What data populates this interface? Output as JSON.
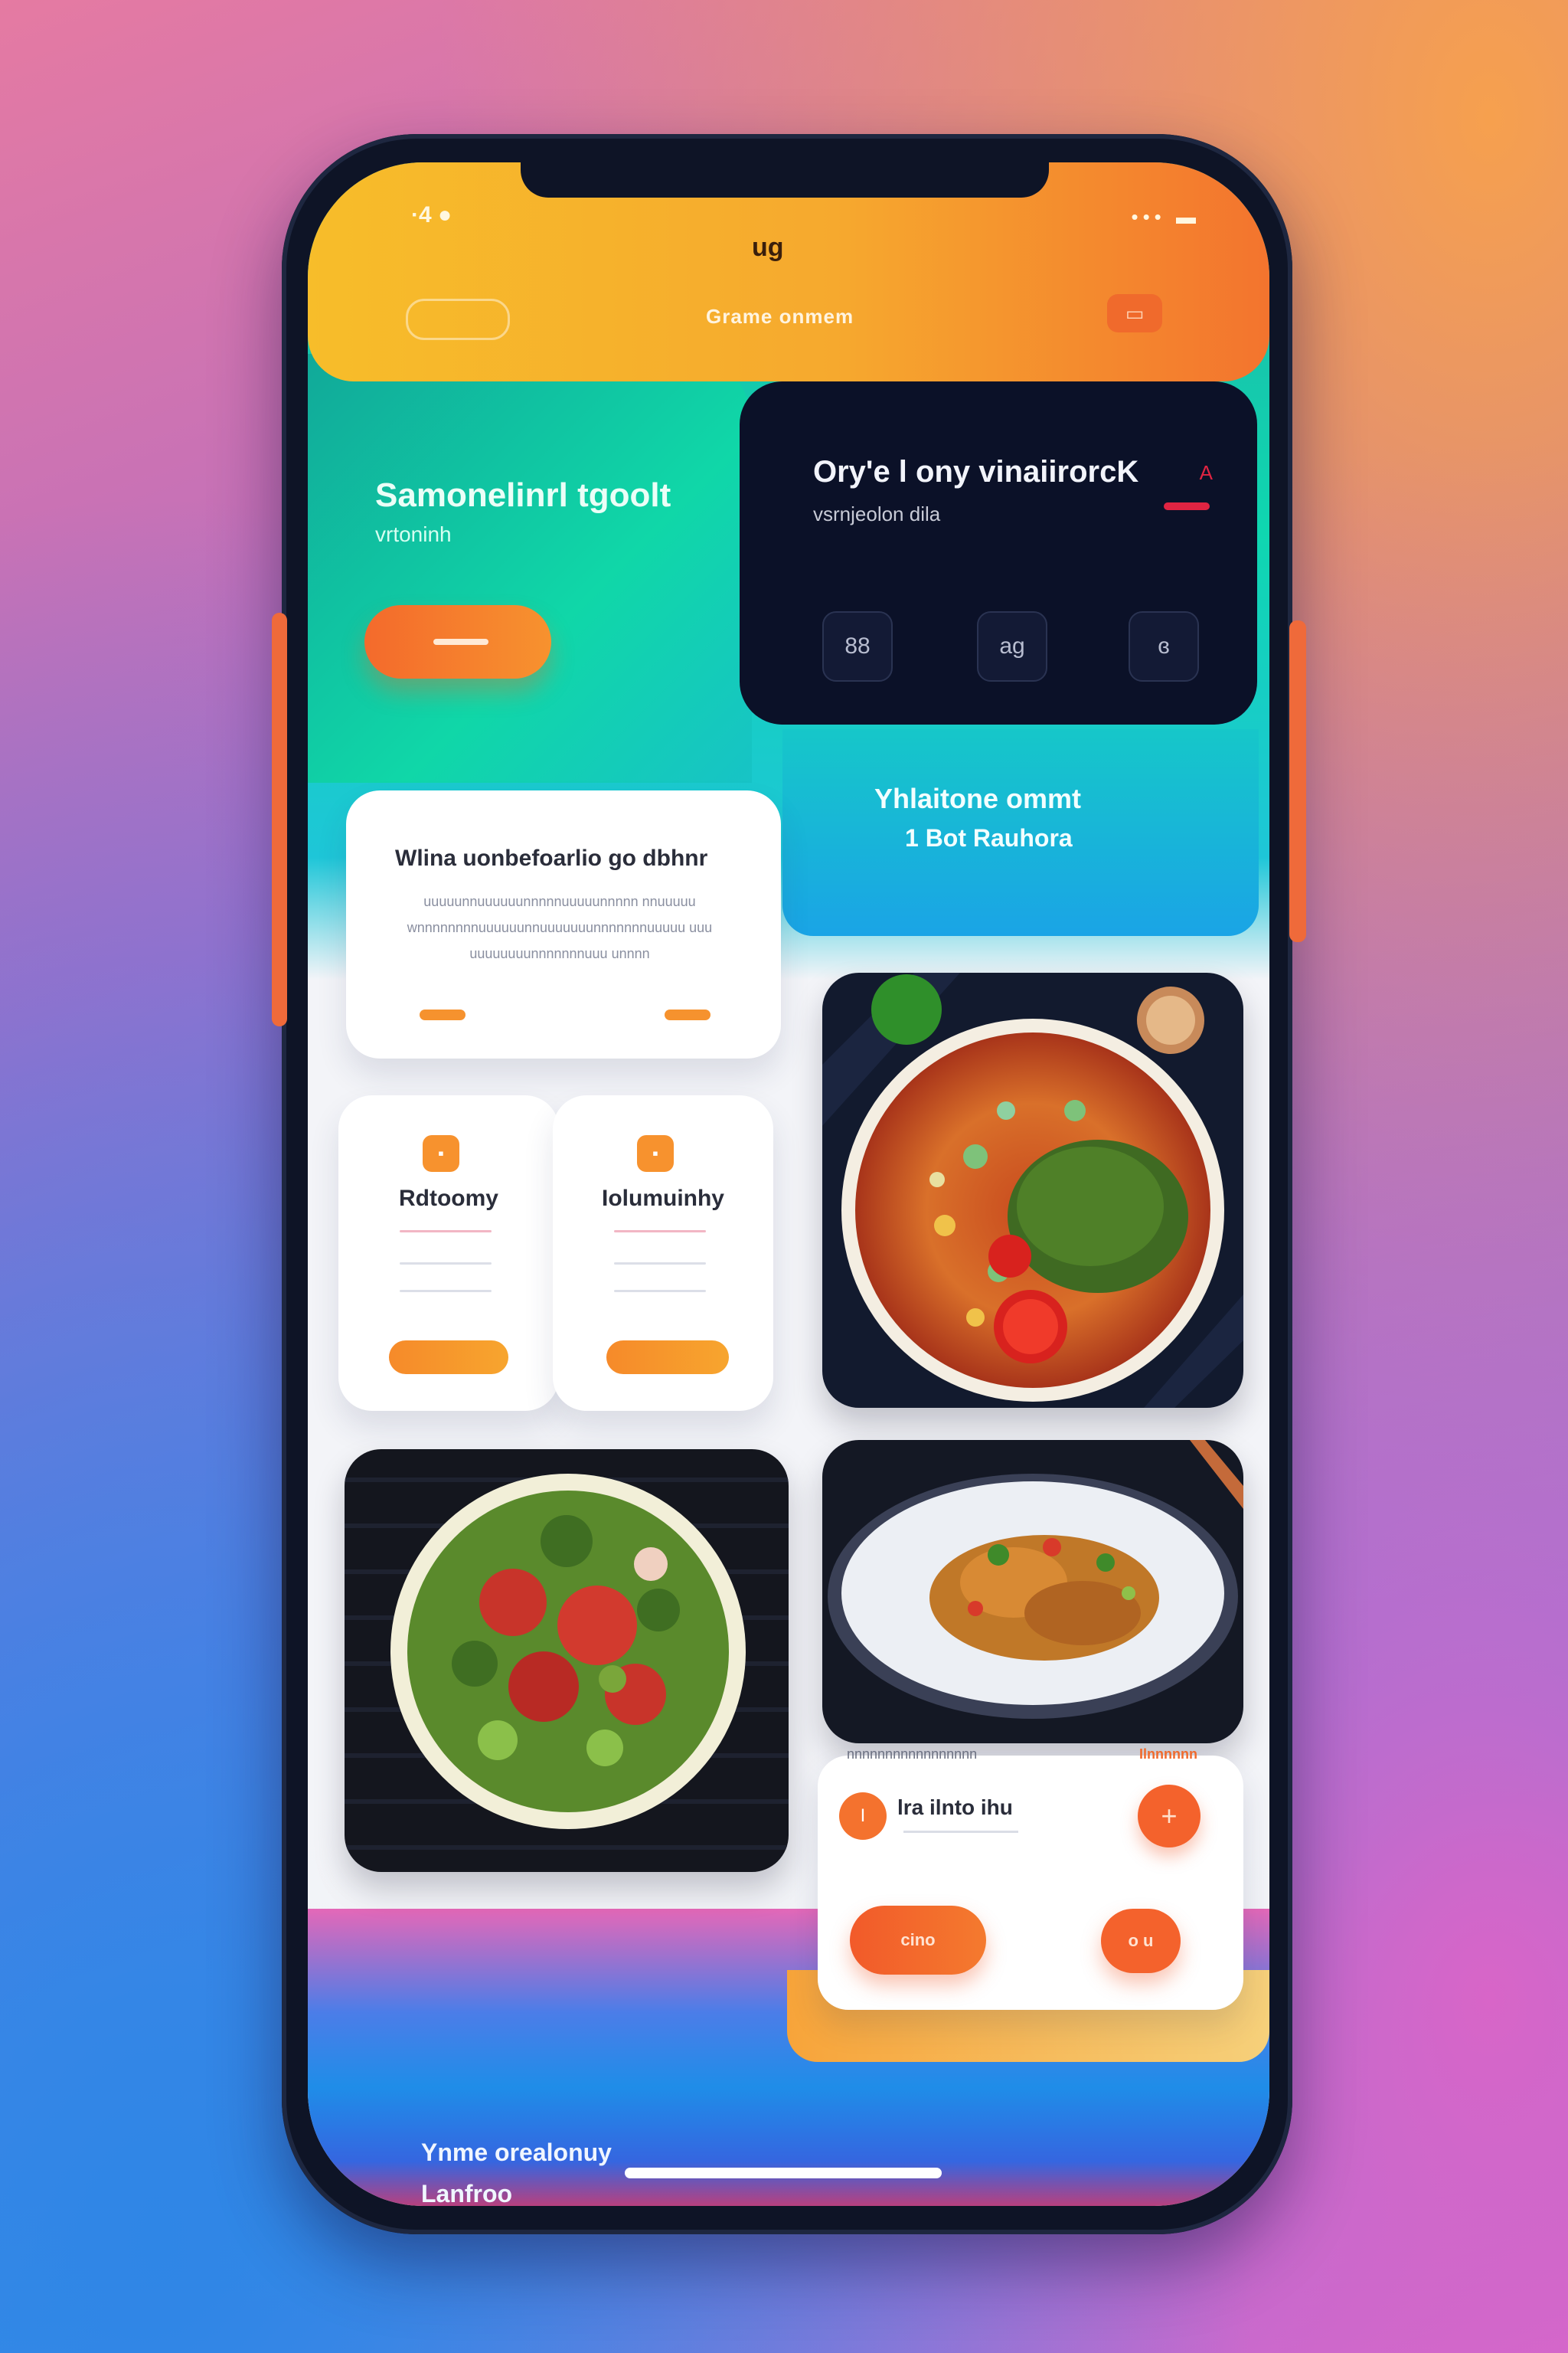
{
  "status_bar": {
    "time": "·4 ●",
    "icons": "••• ▬"
  },
  "header": {
    "logo": "ug",
    "title": "Grame onmem",
    "left_control": "",
    "right_control": "▭"
  },
  "hero": {
    "title": "Samonelinrl tgoolt",
    "subtitle": "vrtoninh"
  },
  "dark_card": {
    "title": "Ory'e l ony vinaiirorcK",
    "subtitle": "vsrnjeolon dila",
    "accent_text": "A",
    "icons": [
      "88",
      "ag",
      "ɞ"
    ]
  },
  "teal_banner": {
    "line1": "Yhlaitone ommt",
    "line2": "1 Bot Rauhora"
  },
  "info_card": {
    "title": "Wlina uonbefoarlio go dbhnr",
    "body": "uuuuunnuuuuuunnnnnuuuuunnnnn nnuuuuu wnnnnnnnnuuuuuunnuuuuuuunnnnnnnuuuuu uuu uuuuuuuunnnnnnnuuu unnnn"
  },
  "mini_cards": [
    {
      "badge": "▪",
      "title": "Rdtoomy"
    },
    {
      "badge": "▪",
      "title": "Iolumuinhy"
    }
  ],
  "order_card": {
    "head_left": "nnnnnnnnnnnnnnnnn",
    "head_right": "Ilnnnnnn",
    "num": "I",
    "name": "lra ilnto ihu",
    "plus": "+",
    "primary_label": "cino",
    "secondary_label": "o u"
  },
  "footer": {
    "line1": "Ynme orealonuy",
    "line2": "Lanfroo"
  },
  "colors": {
    "accent": "#f4722e",
    "brand_yellow": "#f7bd2a",
    "teal": "#10d7a8",
    "dark": "#0b1128"
  }
}
